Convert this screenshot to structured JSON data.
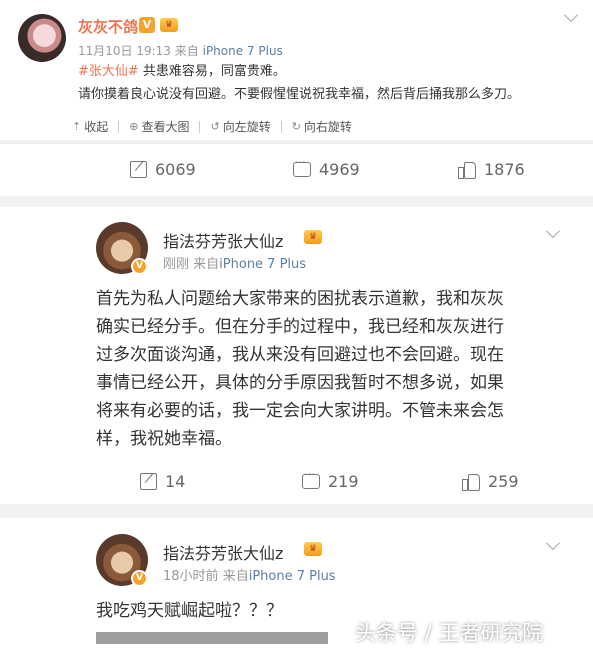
{
  "post1": {
    "author": "灰灰不鸽",
    "verified_badge": "V",
    "member_badge": "VIP",
    "time": "11月10日 19:13",
    "source_prefix": "来自",
    "source": "iPhone 7 Plus",
    "hashtag": "#张大仙#",
    "line1": " 共患难容易，同富贵难。",
    "line2": "请你摸着良心说没有回避。不要假惺惺说祝我幸福，然后背后捅我那么多刀。",
    "toolbar": [
      {
        "icon": "collapse-icon",
        "glyph": "⇡",
        "label": "收起"
      },
      {
        "icon": "zoom-icon",
        "glyph": "⊕",
        "label": "查看大图"
      },
      {
        "icon": "rotate-left-icon",
        "glyph": "↺",
        "label": "向左旋转"
      },
      {
        "icon": "rotate-right-icon",
        "glyph": "↻",
        "label": "向右旋转"
      }
    ],
    "reposts": "6069",
    "comments": "4969",
    "likes": "1876"
  },
  "post2": {
    "author": "指法芬芳张大仙z",
    "time": "刚刚",
    "source_prefix": "来自",
    "source": "iPhone 7 Plus",
    "lines": [
      "首先为私人问题给大家带来的困扰表示道歉，我和灰灰",
      "确实已经分手。但在分手的过程中，我已经和灰灰进行",
      "过多次面谈沟通，我从来没有回避过也不会回避。现在",
      "事情已经公开，具体的分手原因我暂时不想多说，如果",
      "将来有必要的话，我一定会向大家讲明。不管未来会怎",
      "样，我祝她幸福。"
    ],
    "reposts": "14",
    "comments": "219",
    "likes": "259"
  },
  "post3": {
    "author": "指法芬芳张大仙z",
    "time": "18小时前",
    "source_prefix": "来自",
    "source": "iPhone 7 Plus",
    "text": "我吃鸡天赋崛起啦？？？"
  },
  "watermark": "头条号 / 王者研究院",
  "colors": {
    "accent": "#eb7350",
    "source_link": "#5b7fa6",
    "badge": "#f7a32a"
  }
}
